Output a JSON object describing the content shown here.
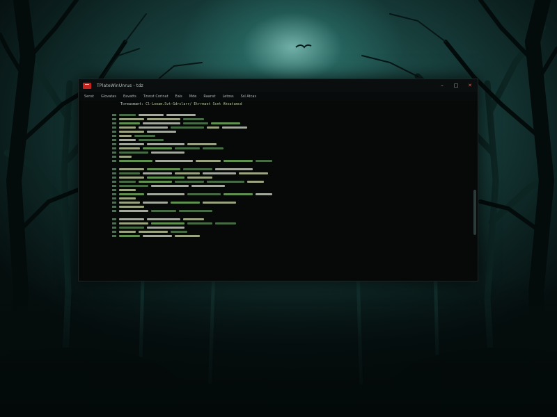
{
  "window": {
    "title": "TPlateWinUnrus - tdz",
    "controls": [
      "–",
      "□",
      "✕"
    ]
  },
  "menu": [
    "Senst",
    "Glovatas",
    "Eavatts",
    "Tzsnst Corinat",
    "Eals",
    "Mde",
    "Raanst",
    "Letoss",
    "Ssl Atcas"
  ],
  "terminal": {
    "header": "Toreaxmant:",
    "command": "Cl-Loeam.Svt-Gdrslarr/ Etrrmaet Scnt Ahoatamcd"
  },
  "colors": {
    "terminal_bg": "#070909",
    "text_green": "#7fbf6a",
    "text_yellow_green": "#cdd8a8",
    "close_button": "#ff4d40",
    "app_icon": "#c3241d"
  }
}
